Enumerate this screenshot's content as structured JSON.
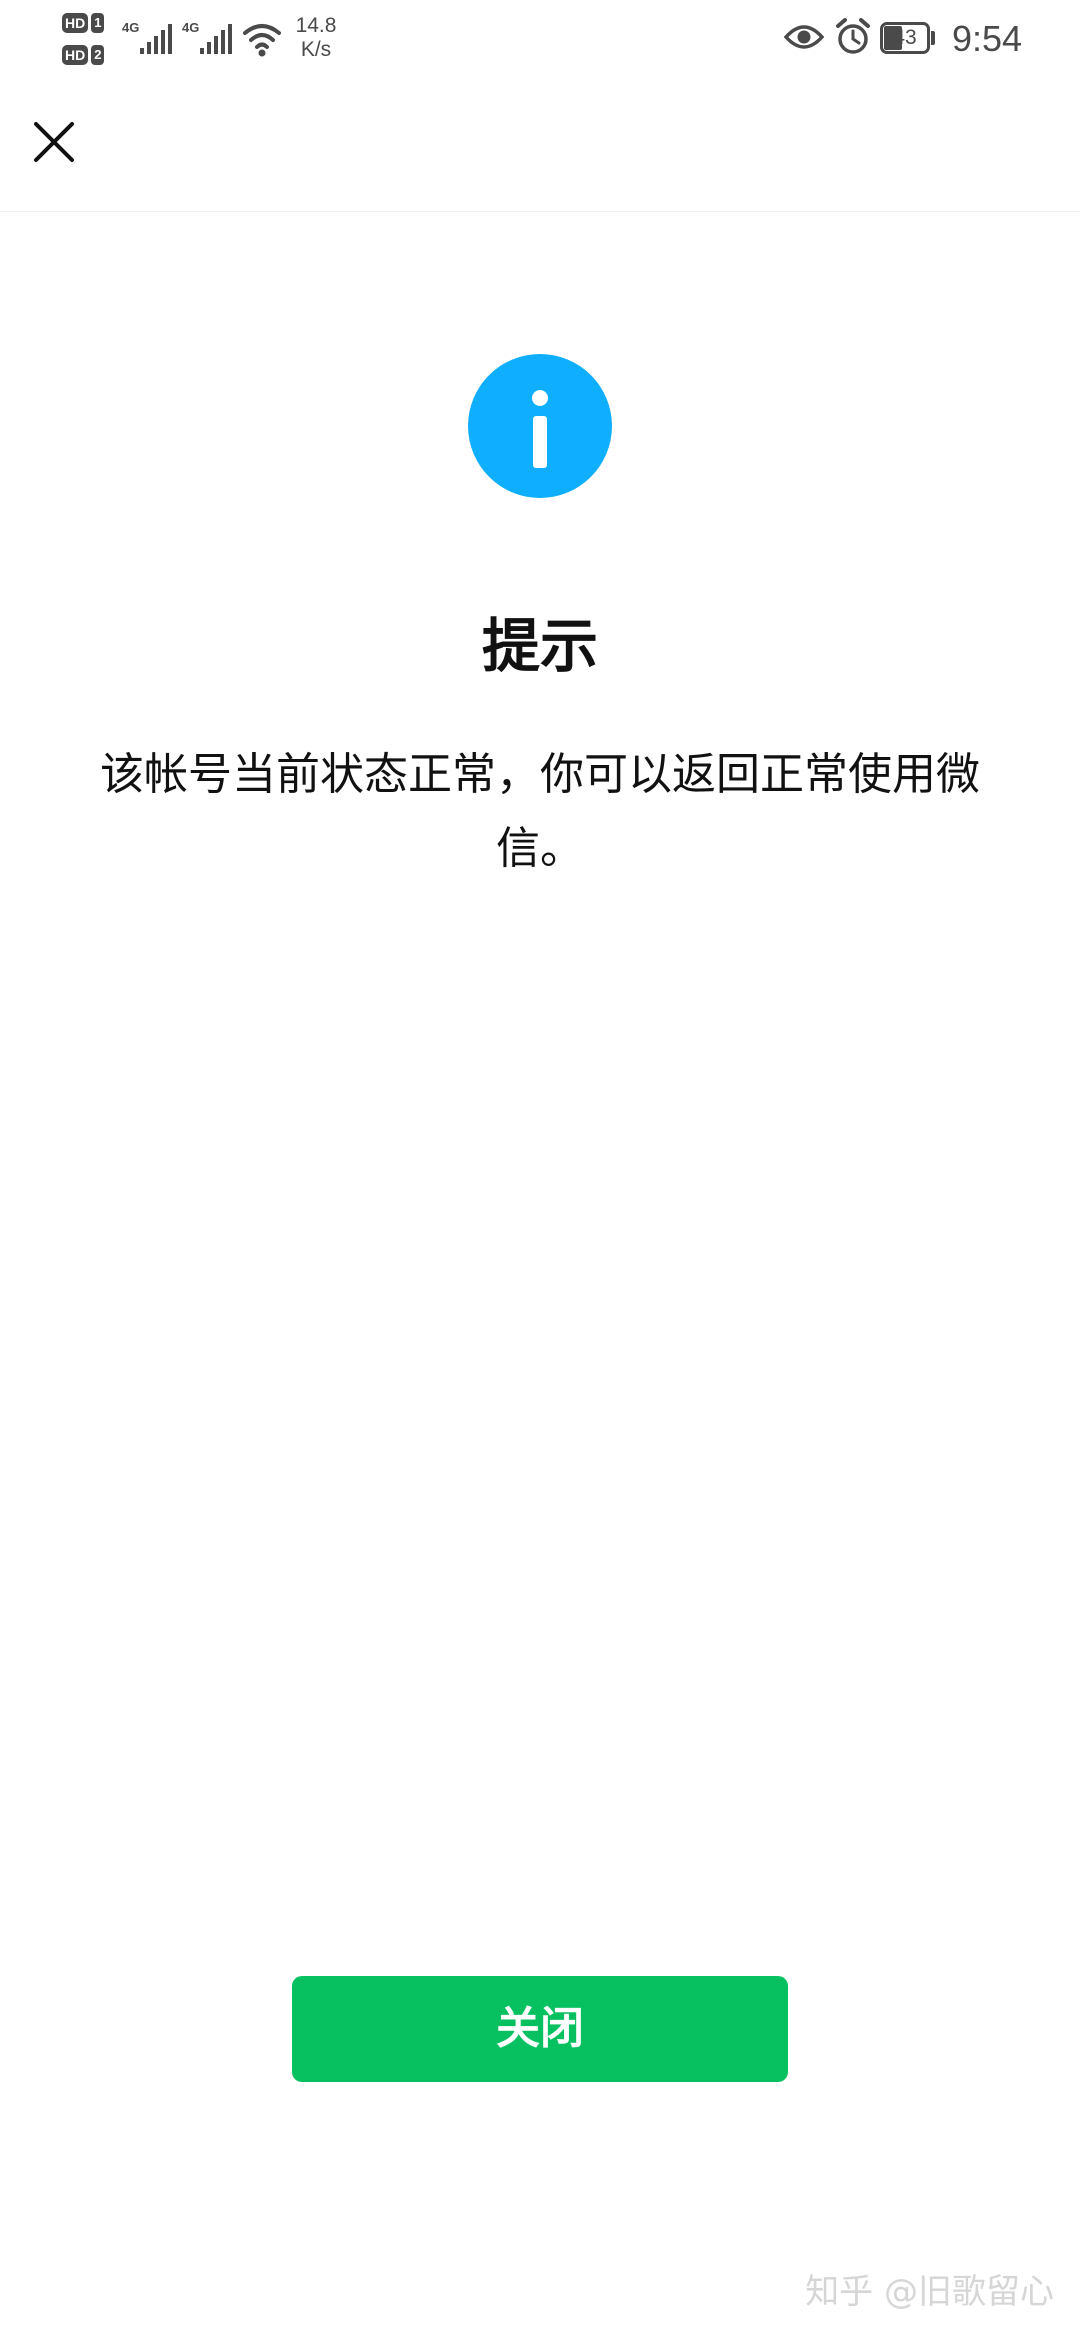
{
  "status_bar": {
    "hd1": "HD",
    "hd1_num": "1",
    "hd2": "HD",
    "hd2_num": "2",
    "network1": "4G",
    "network2": "4G",
    "speed_value": "14.8",
    "speed_unit": "K/s",
    "battery_level": "43",
    "battery_fraction": 0.43,
    "time": "9:54",
    "icons": [
      "hd-icon",
      "signal-icon",
      "wifi-icon",
      "eye-icon",
      "alarm-icon",
      "battery-icon"
    ]
  },
  "nav": {
    "close_icon": "close-icon"
  },
  "dialog": {
    "icon": "info-icon",
    "icon_color": "#10aeff",
    "title": "提示",
    "message": "该帐号当前状态正常，你可以返回正常使用微信。",
    "button_label": "关闭",
    "button_color": "#07c160"
  },
  "watermark": "知乎 @旧歌留心"
}
